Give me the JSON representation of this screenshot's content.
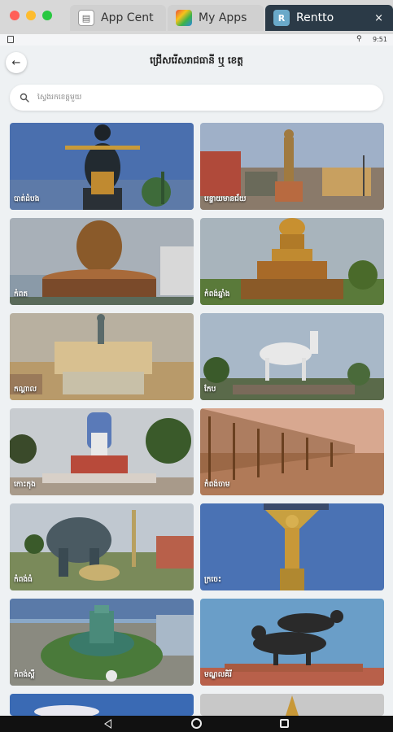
{
  "window": {
    "tabs": [
      {
        "label": "App Cent",
        "icon": "app-center-icon"
      },
      {
        "label": "My Apps",
        "icon": "my-apps-icon"
      },
      {
        "label": "Rentto",
        "icon": "rentto-icon",
        "close": "×",
        "active": true
      }
    ]
  },
  "status_bar": {
    "time": "9:51",
    "location_icon": "location-pin-icon"
  },
  "header": {
    "back_icon": "arrow-left-icon",
    "title": "ជ្រើសរើសរាជធានី ឬ ខេត្ត"
  },
  "search": {
    "placeholder": "ស្វែងរកខេត្តមួយ",
    "icon": "search-icon"
  },
  "provinces": [
    {
      "label": "បាត់ដំបង",
      "accent": "#3a4a7a"
    },
    {
      "label": "បន្ទាយមានជ័យ",
      "accent": "#8a9fbf"
    },
    {
      "label": "កំពត",
      "accent": "#8a6d3b"
    },
    {
      "label": "កំពង់ឆ្នាំង",
      "accent": "#b08a3a"
    },
    {
      "label": "កណ្តាល",
      "accent": "#c9b17a"
    },
    {
      "label": "កែប",
      "accent": "#6d8f6a"
    },
    {
      "label": "កោះកុង",
      "accent": "#7a9cbf"
    },
    {
      "label": "កំពង់ចាម",
      "accent": "#8a6a45"
    },
    {
      "label": "កំពង់ធំ",
      "accent": "#5a6a55"
    },
    {
      "label": "ក្រចេះ",
      "accent": "#5a7fb0"
    },
    {
      "label": "កំពង់ស្ពឺ",
      "accent": "#6a8f5a"
    },
    {
      "label": "មណ្ឌលគិរី",
      "accent": "#6a9ec8"
    }
  ],
  "nav_bar": {
    "back": "nav-back-icon",
    "home": "nav-home-icon",
    "recents": "nav-recents-icon"
  }
}
